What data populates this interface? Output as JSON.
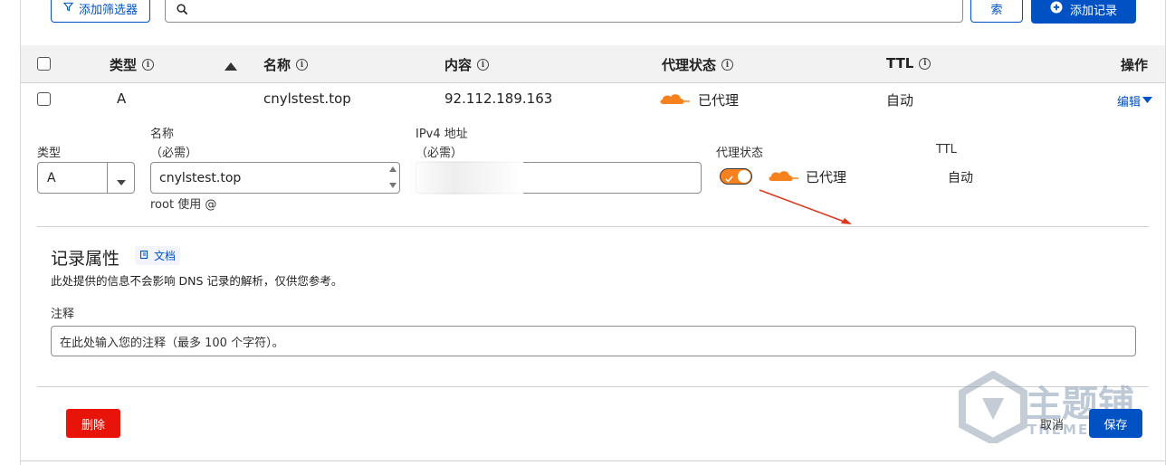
{
  "toolbar": {
    "filter_label": "添加筛选器",
    "search_value": "",
    "search_button_label": "索",
    "add_record_label": "添加记录"
  },
  "table": {
    "headers": {
      "type": "类型",
      "name": "名称",
      "content": "内容",
      "proxy_status": "代理状态",
      "ttl": "TTL",
      "actions": "操作"
    },
    "row": {
      "type": "A",
      "name": "cnylstest.top",
      "content": "92.112.189.163",
      "proxy_status": "已代理",
      "ttl": "自动",
      "edit_label": "编辑"
    }
  },
  "edit_form": {
    "type_label": "类型",
    "type_value": "A",
    "name_label": "名称",
    "name_required": "（必需）",
    "name_value": "cnylstest.top",
    "name_hint": "root 使用 @",
    "ipv4_label": "IPv4 地址",
    "ipv4_required": "（必需）",
    "ipv4_value": "",
    "proxy_label": "代理状态",
    "proxy_value": "已代理",
    "ttl_label": "TTL",
    "ttl_value": "自动"
  },
  "record_attributes": {
    "title": "记录属性",
    "docs_label": "文档",
    "description": "此处提供的信息不会影响 DNS 记录的解析，仅供您参考。",
    "comment_label": "注释",
    "comment_placeholder": "在此处输入您的注释（最多 100 个字符）。"
  },
  "footer": {
    "delete_label": "删除",
    "cancel_label": "取消",
    "save_label": "保存"
  },
  "watermark": {
    "main_text": "主题铺",
    "sub_text": "THEME"
  },
  "colors": {
    "accent": "#0051c3",
    "proxy_orange": "#f6821f",
    "danger": "#e8140a",
    "annotation_arrow": "#d9381e"
  },
  "icons": {
    "filter": "filter-icon",
    "search": "search-icon",
    "add": "plus-circle-icon",
    "info": "info-icon",
    "sort": "sort-up-icon",
    "cloud": "cloud-icon",
    "chevron": "chevron-down-icon",
    "docs": "docs-icon"
  }
}
